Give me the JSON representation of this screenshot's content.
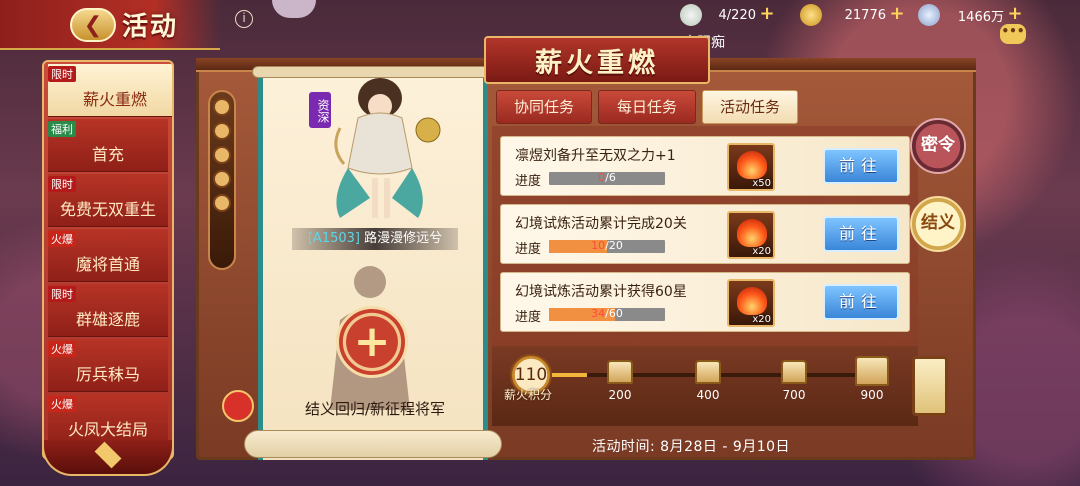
{
  "header": {
    "title": "活动",
    "back_icon": "back-arrow-icon"
  },
  "resources": [
    {
      "name": "stamina",
      "value": "4/220"
    },
    {
      "name": "gold",
      "value": "21776"
    },
    {
      "name": "silver",
      "value": "1466万"
    }
  ],
  "player_name": "太阳痴",
  "sidebar": {
    "items": [
      {
        "tag": "限时",
        "label": "薪火重燃",
        "active": true
      },
      {
        "tag": "福利",
        "label": "首充"
      },
      {
        "tag": "限时",
        "label": "免费无双重生"
      },
      {
        "tag": "火爆",
        "label": "魔将首通"
      },
      {
        "tag": "限时",
        "label": "群雄逐鹿"
      },
      {
        "tag": "火爆",
        "label": "厉兵秣马"
      },
      {
        "tag": "火爆",
        "label": "火凤大结局"
      }
    ]
  },
  "banner_title": "薪火重燃",
  "hero": {
    "quality": "资深",
    "code": "[A1503]",
    "name": "路漫漫修远兮"
  },
  "recruit_label": "结义回归/新征程将军",
  "tabs": [
    {
      "label": "协同任务"
    },
    {
      "label": "每日任务"
    },
    {
      "label": "活动任务",
      "active": true
    }
  ],
  "tasks": [
    {
      "title": "凛煜刘备升至无双之力+1",
      "progress_label": "进度",
      "current": "0",
      "total": "6",
      "progress_fraction": 0.0,
      "reward_count": "x50",
      "button": "前往"
    },
    {
      "title": "幻境试炼活动累计完成20关",
      "progress_label": "进度",
      "current": "10",
      "total": "20",
      "progress_fraction": 0.5,
      "reward_count": "x20",
      "button": "前往"
    },
    {
      "title": "幻境试炼活动累计获得60星",
      "progress_label": "进度",
      "current": "34",
      "total": "60",
      "progress_fraction": 0.567,
      "reward_count": "x20",
      "button": "前往"
    }
  ],
  "points": {
    "current": "110",
    "label": "薪火积分",
    "fill_fraction": 0.11,
    "milestones": [
      "200",
      "400",
      "700",
      "900"
    ]
  },
  "activity_time": "活动时间: 8月28日 - 9月10日",
  "right_buttons": {
    "secret": "密令",
    "sworn": "结义"
  }
}
